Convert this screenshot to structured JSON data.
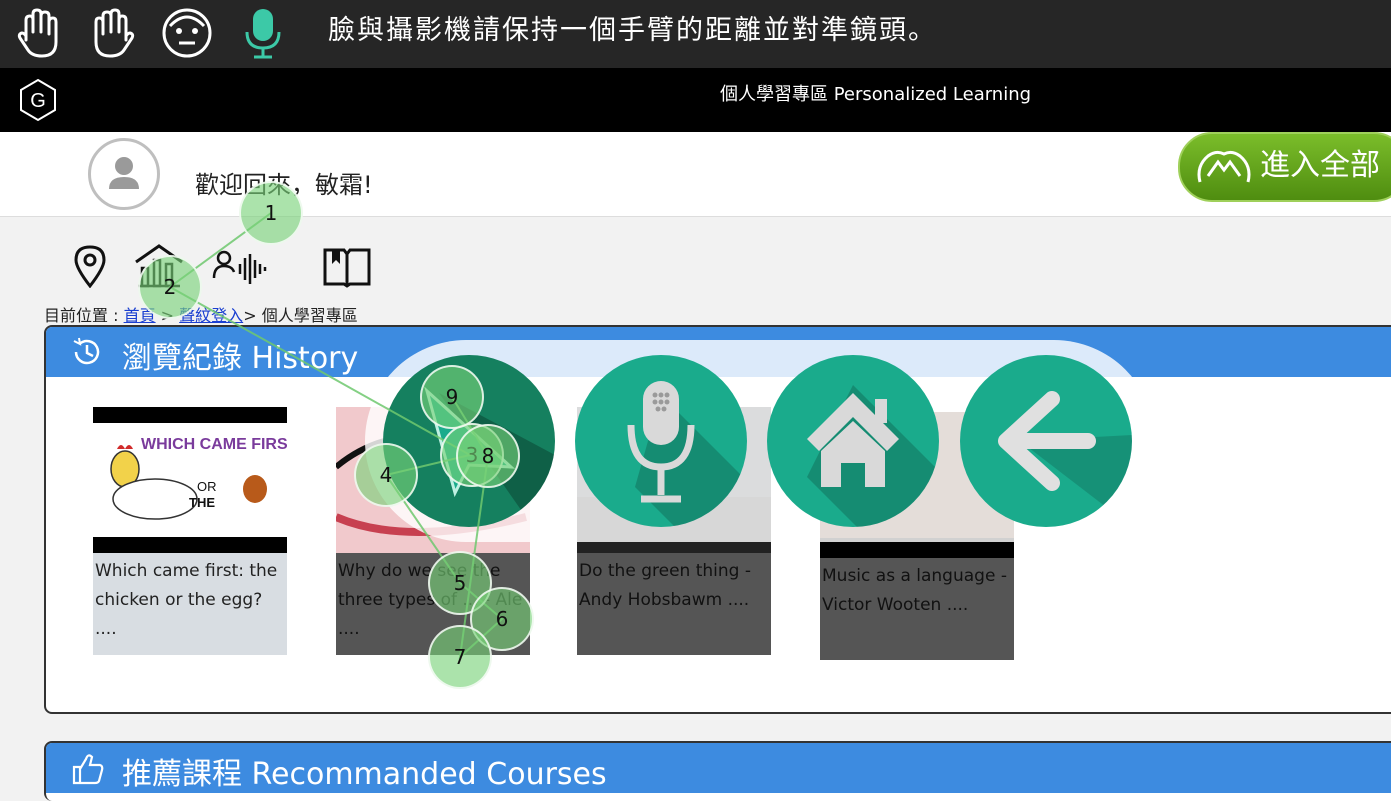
{
  "gesture_bar": {
    "instruction": "臉與攝影機請保持一個手臂的距離並對準鏡頭。",
    "icons": [
      "hand-left-icon",
      "hand-right-icon",
      "face-icon",
      "microphone-icon"
    ],
    "mic_color": "#3cc9a7"
  },
  "header": {
    "site_title": "個人學習專區 Personalized Learning"
  },
  "welcome": {
    "greeting": "歡迎回來，敏霜!",
    "enter_all_label": "進入全部"
  },
  "nav_icons": [
    "location-icon",
    "home-chart-icon",
    "voiceprint-icon",
    "book-icon"
  ],
  "breadcrumb": {
    "prefix": "目前位置 : ",
    "home": "首頁",
    "sep1": " > ",
    "voice_login": "聲紋登入",
    "sep2": "> ",
    "current": "個人學習專區"
  },
  "history": {
    "title": "瀏覽紀錄 History",
    "items": [
      {
        "caption": "Which came first: the chicken or the egg? ....",
        "thumb_title": "WHICH CAME FIRST",
        "thumb_sub1": "OR",
        "thumb_sub2": "THE"
      },
      {
        "caption": "Why do we see the three types of ... - Ale ...."
      },
      {
        "caption": "Do the green thing - Andy Hobsbawm ...."
      },
      {
        "caption": "Music as a language - Victor Wooten ...."
      }
    ]
  },
  "recommended": {
    "title": "推薦課程 Recommanded Courses"
  },
  "overlay_buttons": [
    "pointer-icon",
    "microphone-icon",
    "home-icon",
    "back-arrow-icon"
  ],
  "gaze_points": [
    "1",
    "2",
    "3",
    "4",
    "5",
    "6",
    "7",
    "8",
    "9"
  ],
  "colors": {
    "accent_blue": "#3d8be0",
    "teal": "#1aab8c",
    "green_button": "#5c9c18",
    "gaze_green": "#78d278"
  }
}
